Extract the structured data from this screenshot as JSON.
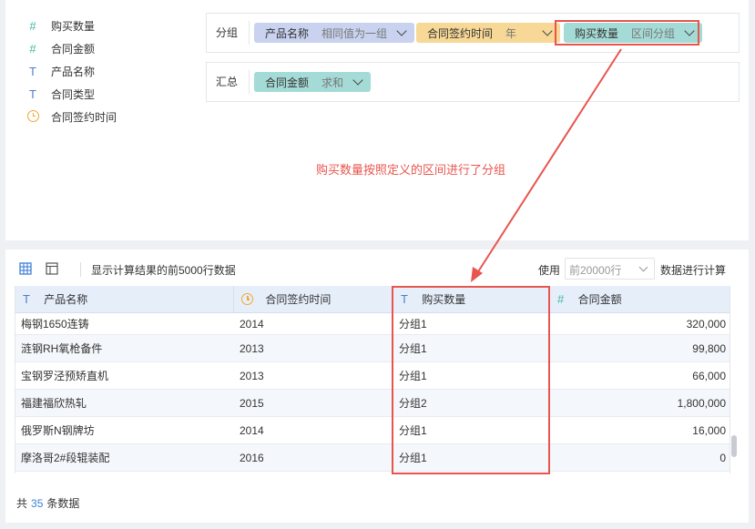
{
  "fields": [
    {
      "icon": "number-icon",
      "symbol": "#",
      "label": "购买数量"
    },
    {
      "icon": "number-icon",
      "symbol": "#",
      "label": "合同金额"
    },
    {
      "icon": "text-icon",
      "symbol": "T",
      "label": "产品名称"
    },
    {
      "icon": "text-icon",
      "symbol": "T",
      "label": "合同类型"
    },
    {
      "icon": "clock-icon",
      "symbol": "",
      "label": "合同签约时间"
    }
  ],
  "group_zone": {
    "label": "分组",
    "pills": [
      {
        "name": "产品名称",
        "option": "相同值为一组",
        "color": "#c9d3ef"
      },
      {
        "name": "合同签约时间",
        "option": "年",
        "color": "#f7d896"
      },
      {
        "name": "购买数量",
        "option": "区间分组",
        "color": "#a5dbd6"
      }
    ]
  },
  "summary_zone": {
    "label": "汇总",
    "pills": [
      {
        "name": "合同金额",
        "option": "求和",
        "color": "#a5dbd6"
      }
    ]
  },
  "annotation": "购买数量按照定义的区间进行了分组",
  "toolbar": {
    "info": "显示计算结果的前5000行数据",
    "use_label": "使用",
    "rows_placeholder": "前20000行",
    "calc_label": "数据进行计算"
  },
  "table": {
    "headers": [
      {
        "icon": "text-icon",
        "label": "产品名称"
      },
      {
        "icon": "clock-icon",
        "label": "合同签约时间"
      },
      {
        "icon": "text-icon",
        "label": "购买数量"
      },
      {
        "icon": "number-icon",
        "label": "合同金额"
      }
    ],
    "rows": [
      [
        "梅钢1650连铸",
        "2014",
        "分组1",
        "320,000"
      ],
      [
        "涟钢RH氧枪备件",
        "2013",
        "分组1",
        "99,800"
      ],
      [
        "宝钢罗泾预矫直机",
        "2013",
        "分组1",
        "66,000"
      ],
      [
        "福建福欣热轧",
        "2015",
        "分组2",
        "1,800,000"
      ],
      [
        "俄罗斯N钢牌坊",
        "2014",
        "分组1",
        "16,000"
      ],
      [
        "摩洛哥2#段辊装配",
        "2016",
        "分组1",
        "0"
      ]
    ]
  },
  "footer": {
    "prefix": "共",
    "count": "35",
    "suffix": "条数据"
  },
  "colors": {
    "accent_red": "#e8554e",
    "link_blue": "#3c7fd8",
    "header_bg": "#e6eefa"
  }
}
